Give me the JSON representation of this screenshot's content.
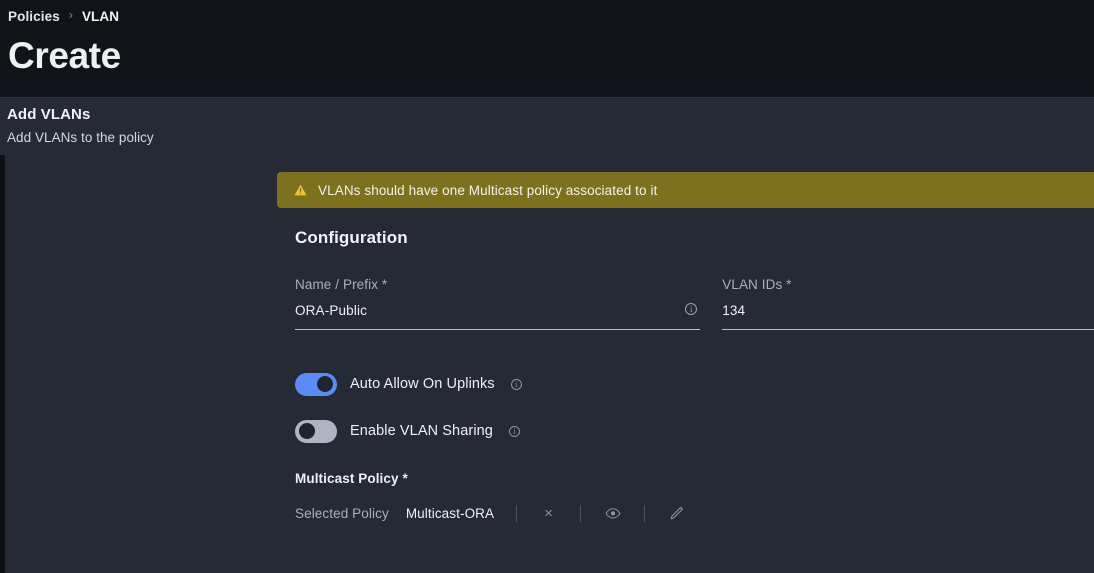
{
  "header": {
    "breadcrumb": [
      {
        "label": "Policies",
        "name": "breadcrumb-policies"
      },
      {
        "label": "VLAN",
        "name": "breadcrumb-vlan"
      }
    ],
    "separator": "›",
    "title": "Create"
  },
  "section": {
    "title": "Add VLANs",
    "subtitle": "Add VLANs to the policy"
  },
  "warning": {
    "icon": "warning-triangle-icon",
    "text": "VLANs should have one Multicast policy associated to it",
    "background": "#7d7120",
    "icon_color": "#f0c133"
  },
  "configuration": {
    "heading": "Configuration",
    "fields": [
      {
        "label": "Name / Prefix *",
        "value": "ORA-Public",
        "placeholder": "Name / Prefix",
        "info_icon": "info-circle-icon"
      },
      {
        "label": "VLAN IDs *",
        "value": "134",
        "placeholder": "VLAN IDs",
        "info_icon": ""
      }
    ],
    "toggles": [
      {
        "label": "Auto Allow On Uplinks",
        "state": "on",
        "info_icon": "info-circle-icon"
      },
      {
        "label": "Enable VLAN Sharing",
        "state": "off",
        "info_icon": "info-circle-icon"
      }
    ],
    "multicast": {
      "title": "Multicast Policy *",
      "selected_label": "Selected Policy",
      "selected_value": "Multicast-ORA",
      "actions": [
        {
          "name": "clear-selection-button",
          "icon": "close-x-icon",
          "label": "×"
        },
        {
          "name": "view-policy-button",
          "icon": "eye-icon",
          "label": ""
        },
        {
          "name": "edit-policy-button",
          "icon": "pencil-icon",
          "label": ""
        }
      ]
    }
  },
  "colors": {
    "header_bg": "#101419",
    "body_bg": "#252a35",
    "toggle_on": "#5b8cf5",
    "toggle_off": "#aeb5c0",
    "accent_warning": "#7d7120"
  }
}
